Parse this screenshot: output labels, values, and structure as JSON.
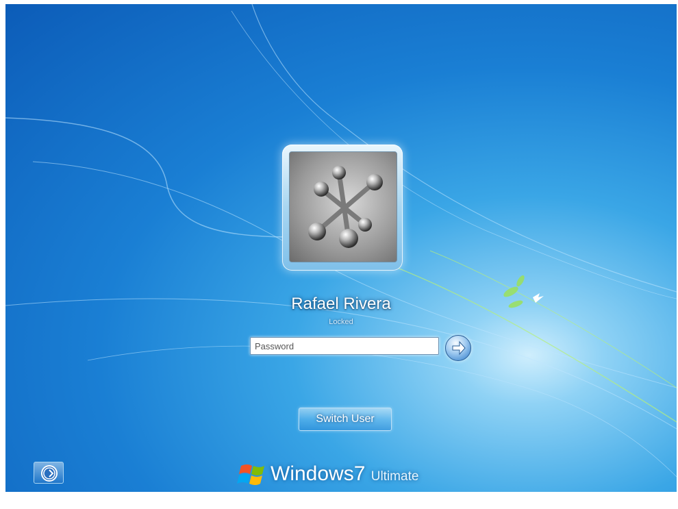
{
  "user": {
    "name": "Rafael Rivera",
    "status": "Locked",
    "avatar_icon": "jacks-icon"
  },
  "password": {
    "value": "",
    "placeholder": "Password"
  },
  "submit": {
    "icon": "arrow-right-icon"
  },
  "switch_user": {
    "label": "Switch User"
  },
  "ease_of_access": {
    "icon": "ease-of-access-icon"
  },
  "branding": {
    "logo": "windows-flag-icon",
    "name": "Windows",
    "version": "7",
    "edition": "Ultimate"
  },
  "colors": {
    "background_deep": "#0c5cb8",
    "background_mid": "#1a7fd4",
    "background_glow": "#cfeefd"
  }
}
